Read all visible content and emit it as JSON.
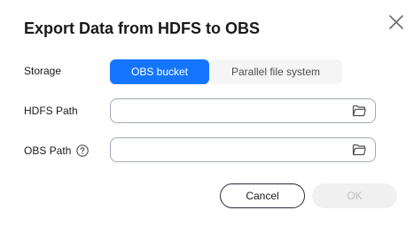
{
  "dialog": {
    "title": "Export Data from HDFS to OBS",
    "close_icon": "close-icon"
  },
  "storage": {
    "label": "Storage",
    "options": [
      {
        "label": "OBS bucket",
        "selected": true
      },
      {
        "label": "Parallel file system",
        "selected": false
      }
    ],
    "accent_color": "#1476ff"
  },
  "hdfs_path": {
    "label": "HDFS Path",
    "value": "",
    "placeholder": "",
    "icon": "folder-icon"
  },
  "obs_path": {
    "label": "OBS Path",
    "help_icon": "question-circle-icon",
    "value": "",
    "placeholder": "",
    "icon": "folder-icon"
  },
  "footer": {
    "cancel_label": "Cancel",
    "ok_label": "OK",
    "ok_disabled": true
  }
}
